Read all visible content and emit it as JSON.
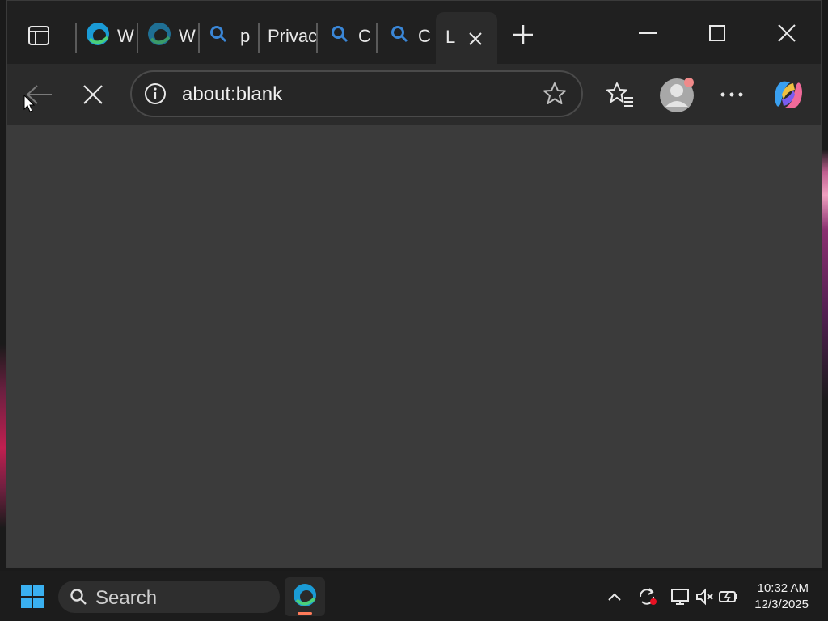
{
  "tabs": [
    {
      "label": "W",
      "icon": "edge-icon"
    },
    {
      "label": "W",
      "icon": "edge-icon"
    },
    {
      "label": "p",
      "icon": "search-icon"
    },
    {
      "label": "Privac",
      "icon": ""
    },
    {
      "label": "C",
      "icon": "search-icon"
    },
    {
      "label": "C",
      "icon": "search-icon"
    },
    {
      "label": "L",
      "icon": ""
    }
  ],
  "address_bar": {
    "url": "about:blank"
  },
  "taskbar": {
    "search_label": "Search",
    "time": "10:32 AM",
    "date": "12/3/2025"
  },
  "colors": {
    "accent_search": "#3a86d6",
    "profile_badge": "#f08a8a",
    "taskbar_indicator": "#ff7b5a"
  }
}
